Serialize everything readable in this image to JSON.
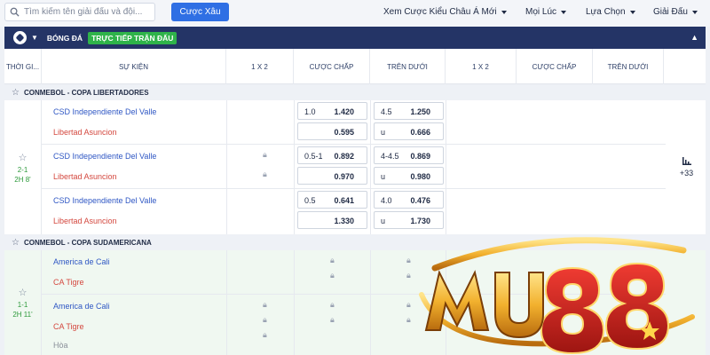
{
  "search": {
    "placeholder": "Tìm kiếm tên giải đấu và đội..."
  },
  "toolbar": {
    "cuoc_xau": "Cược Xâu",
    "view_mode": "Xem Cược Kiểu Châu Á Mới",
    "time_filter": "Mọi Lúc",
    "choose": "Lựa Chọn",
    "league": "Giải Đấu"
  },
  "sport": {
    "title": "BÓNG ĐÁ",
    "live_label": "TRỰC TIẾP TRẬN ĐẤU"
  },
  "columns": [
    "THỜI GI...",
    "SỰ KIỆN",
    "1 X 2",
    "CƯỢC CHẤP",
    "TRÊN DƯỚI",
    "1 X 2",
    "CƯỢC CHẤP",
    "TRÊN DƯỚI"
  ],
  "leagues": [
    {
      "name": "CONMEBOL - COPA LIBERTADORES",
      "score": "2-1",
      "clock": "2H 8'",
      "more": "+33",
      "rows": [
        {
          "home": "CSD Independiente Del Valle",
          "away": "Libertad Asuncion",
          "hcap_line": "1.0",
          "hcap_home": "1.420",
          "hcap_away": "0.595",
          "ou_line": "4.5",
          "ou_over": "1.250",
          "ou_under_label": "u",
          "ou_under": "0.666"
        },
        {
          "home": "CSD Independiente Del Valle",
          "away": "Libertad Asuncion",
          "hcap_line": "0.5-1",
          "hcap_home": "0.892",
          "hcap_away": "0.970",
          "ou_line": "4-4.5",
          "ou_over": "0.869",
          "ou_under_label": "u",
          "ou_under": "0.980"
        },
        {
          "home": "CSD Independiente Del Valle",
          "away": "Libertad Asuncion",
          "hcap_line": "0.5",
          "hcap_home": "0.641",
          "hcap_away": "1.330",
          "ou_line": "4.0",
          "ou_over": "0.476",
          "ou_under_label": "u",
          "ou_under": "1.730"
        }
      ]
    },
    {
      "name": "CONMEBOL - COPA SUDAMERICANA",
      "score": "1-1",
      "clock": "2H 11'",
      "rows": [
        {
          "home": "America de Cali",
          "away": "CA Tigre"
        },
        {
          "home": "America de Cali",
          "away": "CA Tigre",
          "draw": "Hòa"
        }
      ]
    }
  ],
  "logo": {
    "text": "MU88",
    "colors": {
      "gold": "#f2b12e",
      "red": "#c8201f"
    }
  },
  "colors": {
    "accent": "#2f6fe4",
    "header": "#243466",
    "live": "#2fb34a",
    "home": "#2f57c4",
    "away": "#d4483f"
  }
}
